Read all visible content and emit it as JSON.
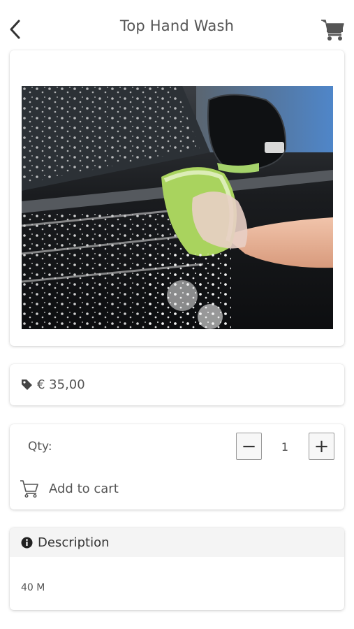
{
  "header": {
    "title": "Top Hand Wash",
    "back_icon": "chevron-left-icon",
    "cart_icon": "shopping-cart-icon"
  },
  "product": {
    "image_description": "photo of a hand washing a black car with a soapy green sponge",
    "price": "€ 35,00",
    "price_icon": "tag-icon"
  },
  "quantity": {
    "label": "Qty:",
    "value": "1",
    "minus_label": "−",
    "plus_label": "+"
  },
  "cart_action": {
    "label": "Add to cart",
    "icon": "cart-outline-icon"
  },
  "description": {
    "title": "Description",
    "icon": "info-icon",
    "body": "40 M"
  },
  "colors": {
    "text": "#555555",
    "card_background": "#ffffff",
    "description_header_background": "#f4f4f4",
    "button_border": "#9a9a9a"
  }
}
